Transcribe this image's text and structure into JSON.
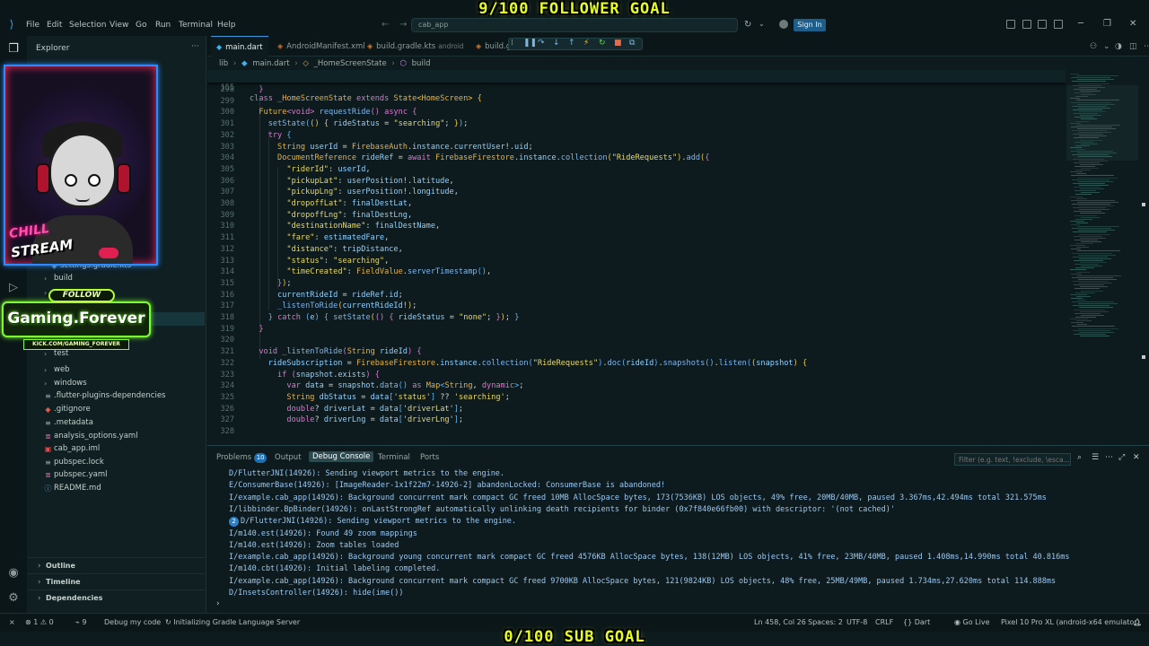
{
  "overlay": {
    "follower_goal": "9/100 FOLLOWER GOAL",
    "sub_goal": "0/100 SUB GOAL",
    "chill": "CHILL",
    "stream": "STREAM",
    "follow": "FOLLOW",
    "channel": "Gaming.Forever",
    "kick_url": "KICK.COM/GAMING_FOREVER"
  },
  "titlebar": {
    "menu": [
      "File",
      "Edit",
      "Selection",
      "View",
      "Go",
      "Run",
      "Terminal",
      "Help"
    ],
    "search": "cab_app",
    "sign_in": "Sign In"
  },
  "sidebar": {
    "title": "Explorer",
    "more": "···",
    "tree": [
      {
        "label": "settings.gradle.kts",
        "icon": "gradle-icon",
        "indent": 2
      },
      {
        "label": "build",
        "icon": "folder-icon",
        "indent": 1,
        "chev": "›"
      },
      {
        "label": "",
        "icon": "folder-icon",
        "indent": 1,
        "chev": "›"
      },
      {
        "label": "",
        "icon": "folder-icon",
        "indent": 1,
        "chev": "›"
      },
      {
        "label": "",
        "icon": "folder-icon",
        "indent": 1,
        "chev": "›"
      },
      {
        "label": "test",
        "icon": "folder-icon",
        "indent": 1,
        "chev": "›"
      },
      {
        "label": "web",
        "icon": "folder-icon",
        "indent": 1,
        "chev": "›"
      },
      {
        "label": "windows",
        "icon": "folder-icon",
        "indent": 1,
        "chev": "›"
      },
      {
        "label": ".flutter-plugins-dependencies",
        "icon": "file-icon",
        "indent": 1
      },
      {
        "label": ".gitignore",
        "icon": "git-icon",
        "indent": 1
      },
      {
        "label": ".metadata",
        "icon": "file-icon",
        "indent": 1
      },
      {
        "label": "analysis_options.yaml",
        "icon": "yaml-icon",
        "indent": 1
      },
      {
        "label": "cab_app.iml",
        "icon": "iml-icon",
        "indent": 1
      },
      {
        "label": "pubspec.lock",
        "icon": "lock-icon",
        "indent": 1
      },
      {
        "label": "pubspec.yaml",
        "icon": "yaml-icon",
        "indent": 1
      },
      {
        "label": "README.md",
        "icon": "info-icon",
        "indent": 1
      }
    ],
    "sections": [
      "Outline",
      "Timeline",
      "Dependencies"
    ]
  },
  "tabs": [
    {
      "label": "main.dart",
      "desc": "",
      "icon": "dart",
      "active": true
    },
    {
      "label": "AndroidManifest.xml",
      "desc": "",
      "icon": "xml",
      "active": false
    },
    {
      "label": "build.gradle.kts",
      "desc": "android",
      "icon": "gradle",
      "active": false
    },
    {
      "label": "build.gra",
      "desc": "",
      "icon": "gradle",
      "active": false
    }
  ],
  "breadcrumb": [
    "lib",
    "main.dart",
    "_HomeScreenState",
    "build"
  ],
  "sticky": {
    "ln": "155",
    "html": "<span class=\"kw\">class</span> <span class=\"ty\">_HomeScreenState</span> <span class=\"kw\">extends</span> <span class=\"ty\">State</span><span class=\"br1\">&lt;</span><span class=\"ty\">HomeScreen</span><span class=\"br1\">&gt;</span> <span class=\"br1\">{</span>"
  },
  "code": [
    {
      "ln": "298",
      "html": "  <span class=\"br2\">}</span>"
    },
    {
      "ln": "299",
      "html": ""
    },
    {
      "ln": "300",
      "html": "  <span class=\"ty\">Future</span><span class=\"br2\">&lt;</span><span class=\"kw\">void</span><span class=\"br2\">&gt;</span> <span class=\"fn\">requestRide</span><span class=\"br2\">()</span> <span class=\"kw\">async</span> <span class=\"br2\">{</span>"
    },
    {
      "ln": "301",
      "html": "    <span class=\"fn\">setState</span><span class=\"br3\">(</span><span class=\"br1\">()</span> <span class=\"br1\">{</span> <span class=\"var\">rideStatus</span> = <span class=\"str\">\"searching\"</span>; <span class=\"br1\">}</span><span class=\"br3\">)</span>;"
    },
    {
      "ln": "302",
      "html": "    <span class=\"kw\">try</span> <span class=\"br3\">{</span>"
    },
    {
      "ln": "303",
      "html": "      <span class=\"ty\">String</span> <span class=\"var\">userId</span> = <span class=\"ty\">FirebaseAuth</span>.<span class=\"var\">instance</span>.<span class=\"var\">currentUser</span>!.<span class=\"var\">uid</span>;"
    },
    {
      "ln": "304",
      "html": "      <span class=\"ty\">DocumentReference</span> <span class=\"var\">rideRef</span> = <span class=\"kw\">await</span> <span class=\"ty\">FirebaseFirestore</span>.<span class=\"var\">instance</span>.<span class=\"fn\">collection</span><span class=\"br1\">(</span><span class=\"str\">\"RideRequests\"</span><span class=\"br1\">)</span>.<span class=\"fn\">add</span><span class=\"br1\">(</span><span class=\"br2\">{</span>"
    },
    {
      "ln": "305",
      "html": "        <span class=\"str\">\"riderId\"</span>: <span class=\"var\">userId</span>,"
    },
    {
      "ln": "306",
      "html": "        <span class=\"str\">\"pickupLat\"</span>: <span class=\"var\">userPosition</span>!.<span class=\"var\">latitude</span>,"
    },
    {
      "ln": "307",
      "html": "        <span class=\"str\">\"pickupLng\"</span>: <span class=\"var\">userPosition</span>!.<span class=\"var\">longitude</span>,"
    },
    {
      "ln": "308",
      "html": "        <span class=\"str\">\"dropoffLat\"</span>: <span class=\"var\">finalDestLat</span>,"
    },
    {
      "ln": "309",
      "html": "        <span class=\"str\">\"dropoffLng\"</span>: <span class=\"var\">finalDestLng</span>,"
    },
    {
      "ln": "310",
      "html": "        <span class=\"str\">\"destinationName\"</span>: <span class=\"var\">finalDestName</span>,"
    },
    {
      "ln": "311",
      "html": "        <span class=\"str\">\"fare\"</span>: <span class=\"var\">estimatedFare</span>,"
    },
    {
      "ln": "312",
      "html": "        <span class=\"str\">\"distance\"</span>: <span class=\"var\">tripDistance</span>,"
    },
    {
      "ln": "313",
      "html": "        <span class=\"str\">\"status\"</span>: <span class=\"str\">\"searching\"</span>,"
    },
    {
      "ln": "314",
      "html": "        <span class=\"str\">\"timeCreated\"</span>: <span class=\"ty\">FieldValue</span>.<span class=\"fn\">serverTimestamp</span><span class=\"br3\">()</span>,"
    },
    {
      "ln": "315",
      "html": "      <span class=\"br2\">}</span><span class=\"br1\">)</span>;"
    },
    {
      "ln": "316",
      "html": "      <span class=\"var\">currentRideId</span> = <span class=\"var\">rideRef</span>.<span class=\"var\">id</span>;"
    },
    {
      "ln": "317",
      "html": "      <span class=\"fn\">_listenToRide</span><span class=\"br1\">(</span><span class=\"var\">currentRideId</span>!<span class=\"br1\">)</span>;"
    },
    {
      "ln": "318",
      "html": "    <span class=\"br3\">}</span> <span class=\"kw\">catch</span> <span class=\"br3\">(</span><span class=\"var\">e</span><span class=\"br3\">)</span> <span class=\"br3\">{</span> <span class=\"fn\">setState</span><span class=\"br1\">(</span><span class=\"br2\">()</span> <span class=\"br2\">{</span> <span class=\"var\">rideStatus</span> = <span class=\"str\">\"none\"</span>; <span class=\"br2\">}</span><span class=\"br1\">)</span>; <span class=\"br3\">}</span>"
    },
    {
      "ln": "319",
      "html": "  <span class=\"br2\">}</span>"
    },
    {
      "ln": "320",
      "html": ""
    },
    {
      "ln": "321",
      "html": "  <span class=\"kw\">void</span> <span class=\"fn\">_listenToRide</span><span class=\"br2\">(</span><span class=\"ty\">String</span> <span class=\"var\">rideId</span><span class=\"br2\">)</span> <span class=\"br2\">{</span>"
    },
    {
      "ln": "322",
      "html": "    <span class=\"var\">rideSubscription</span> = <span class=\"ty\">FirebaseFirestore</span>.<span class=\"var\">instance</span>.<span class=\"fn\">collection</span><span class=\"br3\">(</span><span class=\"str\">\"RideRequests\"</span><span class=\"br3\">)</span>.<span class=\"fn\">doc</span><span class=\"br3\">(</span><span class=\"var\">rideId</span><span class=\"br3\">)</span>.<span class=\"fn\">snapshots</span><span class=\"br3\">()</span>.<span class=\"fn\">listen</span><span class=\"br3\">(</span><span class=\"br1\">(</span><span class=\"var\">snapshot</span><span class=\"br1\">)</span> <span class=\"br1\">{</span>"
    },
    {
      "ln": "323",
      "html": "      <span class=\"kw\">if</span> <span class=\"br2\">(</span><span class=\"var\">snapshot</span>.<span class=\"var\">exists</span><span class=\"br2\">)</span> <span class=\"br2\">{</span>"
    },
    {
      "ln": "324",
      "html": "        <span class=\"kw\">var</span> <span class=\"var\">data</span> = <span class=\"var\">snapshot</span>.<span class=\"fn\">data</span><span class=\"br3\">()</span> <span class=\"kw\">as</span> <span class=\"ty\">Map</span><span class=\"br3\">&lt;</span><span class=\"ty\">String</span>, <span class=\"kw\">dynamic</span><span class=\"br3\">&gt;</span>;"
    },
    {
      "ln": "325",
      "html": "        <span class=\"ty\">String</span> <span class=\"var\">dbStatus</span> = <span class=\"var\">data</span><span class=\"br3\">[</span><span class=\"str\">'status'</span><span class=\"br3\">]</span> ?? <span class=\"str\">'searching'</span>;"
    },
    {
      "ln": "326",
      "html": "        <span class=\"kw\">double</span>? <span class=\"var\">driverLat</span> = <span class=\"var\">data</span><span class=\"br3\">[</span><span class=\"str\">'driverLat'</span><span class=\"br3\">]</span>;"
    },
    {
      "ln": "327",
      "html": "        <span class=\"kw\">double</span>? <span class=\"var\">driverLng</span> = <span class=\"var\">data</span><span class=\"br3\">[</span><span class=\"str\">'driverLng'</span><span class=\"br3\">]</span>;"
    },
    {
      "ln": "328",
      "html": ""
    }
  ],
  "panel": {
    "tabs": [
      "Problems",
      "Output",
      "Debug Console",
      "Terminal",
      "Ports"
    ],
    "problems_count": "10",
    "filter_placeholder": "Filter (e.g. text, !exclude, \\esca...",
    "logs": [
      {
        "badge": "",
        "text": "D/FlutterJNI(14926): Sending viewport metrics to the engine."
      },
      {
        "badge": "",
        "text": "E/ConsumerBase(14926): [ImageReader-1x1f22m7-14926-2] abandonLocked: ConsumerBase is abandoned!"
      },
      {
        "badge": "",
        "text": "I/example.cab_app(14926): Background concurrent mark compact GC freed 10MB AllocSpace bytes, 173(7536KB) LOS objects, 49% free, 20MB/40MB, paused 3.367ms,42.494ms total 321.575ms"
      },
      {
        "badge": "",
        "text": "I/libbinder.BpBinder(14926): onLastStrongRef automatically unlinking death recipients for binder (0x7f840e66fb00) with descriptor: '(not cached)'"
      },
      {
        "badge": "2",
        "text": "D/FlutterJNI(14926): Sending viewport metrics to the engine."
      },
      {
        "badge": "",
        "text": "I/m140.est(14926): Found 49 zoom mappings"
      },
      {
        "badge": "",
        "text": "I/m140.est(14926): Zoom tables loaded"
      },
      {
        "badge": "",
        "text": "I/example.cab_app(14926): Background young concurrent mark compact GC freed 4576KB AllocSpace bytes, 138(12MB) LOS objects, 41% free, 23MB/40MB, paused 1.408ms,14.990ms total 40.816ms"
      },
      {
        "badge": "",
        "text": "I/m140.cbt(14926): Initial labeling completed."
      },
      {
        "badge": "",
        "text": "I/example.cab_app(14926): Background concurrent mark compact GC freed 9700KB AllocSpace bytes, 121(9824KB) LOS objects, 48% free, 25MB/49MB, paused 1.734ms,27.620ms total 114.888ms"
      },
      {
        "badge": "",
        "text": "D/InsetsController(14926): hide(ime())"
      }
    ],
    "prompt": "›"
  },
  "statusbar": {
    "remote": "⨯",
    "errors": "1",
    "warnings": "0",
    "ports": "9",
    "debug": "Debug my code",
    "init": "Initializing Gradle Language Server",
    "position": "Ln 458, Col 26",
    "spaces": "Spaces: 2",
    "encoding": "UTF-8",
    "eol": "CRLF",
    "language": "Dart",
    "golive": "Go Live",
    "device": "Pixel 10 Pro XL (android-x64 emulator)"
  }
}
